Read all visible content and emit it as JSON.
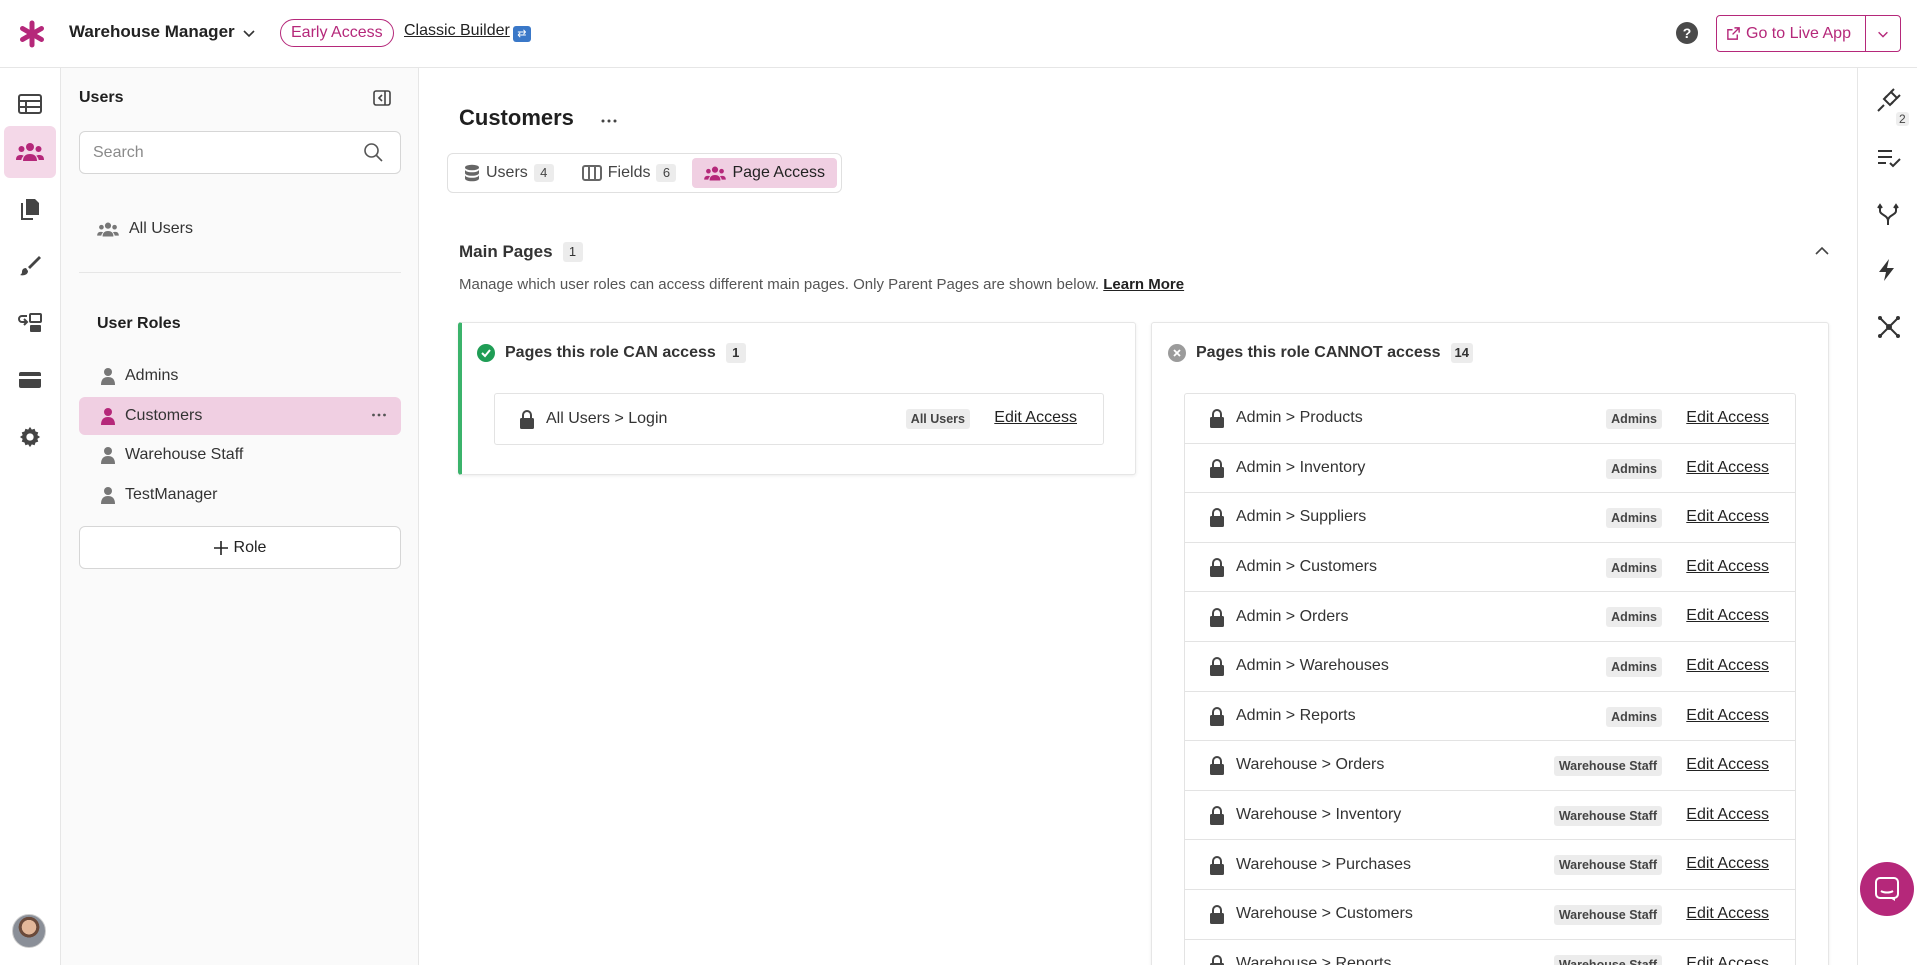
{
  "header": {
    "app_name": "Warehouse Manager",
    "early_access": "Early Access",
    "classic_builder": "Classic Builder",
    "classic_emoji": "🔀",
    "help": "?",
    "live_app": "Go to Live App",
    "accent": "#b5287a"
  },
  "sidebar": {
    "title": "Users",
    "search_placeholder": "Search",
    "all_users": "All Users",
    "roles_title": "User Roles",
    "roles": [
      "Admins",
      "Customers",
      "Warehouse Staff",
      "TestManager"
    ],
    "active_role": "Customers",
    "add_role": "Role"
  },
  "main": {
    "title": "Customers",
    "tabs": [
      {
        "label": "Users",
        "count": "4",
        "icon": "database-icon"
      },
      {
        "label": "Fields",
        "count": "6",
        "icon": "columns-icon"
      },
      {
        "label": "Page Access",
        "count": "",
        "icon": "users-icon"
      }
    ],
    "section_title": "Main Pages",
    "section_count": "1",
    "description": "Manage which user roles can access different main pages. Only Parent Pages are shown below.",
    "learn_more": "Learn More",
    "can": {
      "title": "Pages this role CAN access",
      "count": "1",
      "rows": [
        {
          "page": "All Users > Login",
          "tag": "All Users",
          "action": "Edit Access"
        }
      ]
    },
    "cannot": {
      "title": "Pages this role CANNOT access",
      "count": "14",
      "rows": [
        {
          "page": "Admin > Products",
          "tag": "Admins",
          "action": "Edit Access"
        },
        {
          "page": "Admin > Inventory",
          "tag": "Admins",
          "action": "Edit Access"
        },
        {
          "page": "Admin > Suppliers",
          "tag": "Admins",
          "action": "Edit Access"
        },
        {
          "page": "Admin > Customers",
          "tag": "Admins",
          "action": "Edit Access"
        },
        {
          "page": "Admin > Orders",
          "tag": "Admins",
          "action": "Edit Access"
        },
        {
          "page": "Admin > Warehouses",
          "tag": "Admins",
          "action": "Edit Access"
        },
        {
          "page": "Admin > Reports",
          "tag": "Admins",
          "action": "Edit Access"
        },
        {
          "page": "Warehouse > Orders",
          "tag": "Warehouse Staff",
          "action": "Edit Access"
        },
        {
          "page": "Warehouse > Inventory",
          "tag": "Warehouse Staff",
          "action": "Edit Access"
        },
        {
          "page": "Warehouse > Purchases",
          "tag": "Warehouse Staff",
          "action": "Edit Access"
        },
        {
          "page": "Warehouse > Customers",
          "tag": "Warehouse Staff",
          "action": "Edit Access"
        },
        {
          "page": "Warehouse > Reports",
          "tag": "Warehouse Staff",
          "action": "Edit Access"
        }
      ]
    }
  },
  "right_rail": {
    "plugin_count": "2"
  }
}
